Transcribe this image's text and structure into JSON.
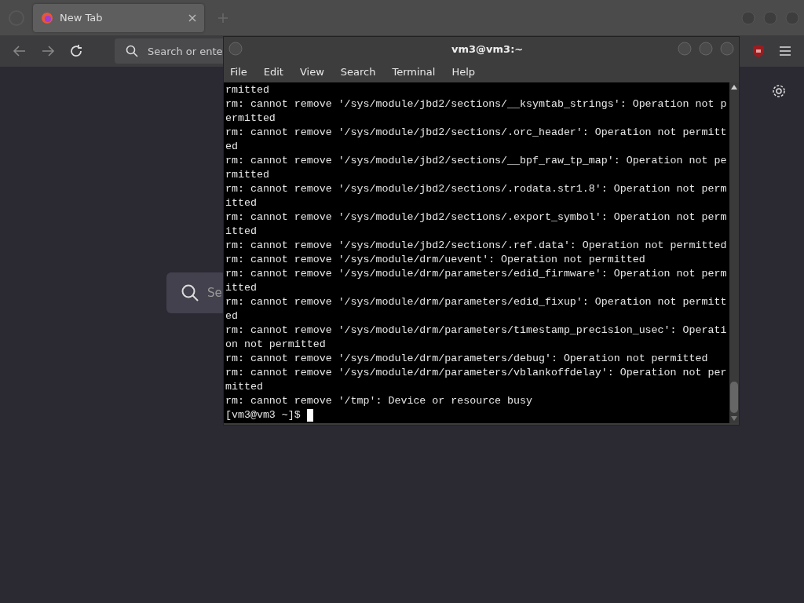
{
  "browser": {
    "tabs": [
      {
        "label": "New Tab",
        "selected": true
      }
    ],
    "address_bar": {
      "placeholder": "Search or ente"
    },
    "page_search": {
      "placeholder": "Se"
    }
  },
  "terminal": {
    "title": "vm3@vm3:~",
    "menu": [
      "File",
      "Edit",
      "View",
      "Search",
      "Terminal",
      "Help"
    ],
    "lines": [
      "rmitted",
      "rm: cannot remove '/sys/module/jbd2/sections/__ksymtab_strings': Operation not p",
      "ermitted",
      "rm: cannot remove '/sys/module/jbd2/sections/.orc_header': Operation not permitt",
      "ed",
      "rm: cannot remove '/sys/module/jbd2/sections/__bpf_raw_tp_map': Operation not pe",
      "rmitted",
      "rm: cannot remove '/sys/module/jbd2/sections/.rodata.str1.8': Operation not perm",
      "itted",
      "rm: cannot remove '/sys/module/jbd2/sections/.export_symbol': Operation not perm",
      "itted",
      "rm: cannot remove '/sys/module/jbd2/sections/.ref.data': Operation not permitted",
      "rm: cannot remove '/sys/module/drm/uevent': Operation not permitted",
      "rm: cannot remove '/sys/module/drm/parameters/edid_firmware': Operation not perm",
      "itted",
      "rm: cannot remove '/sys/module/drm/parameters/edid_fixup': Operation not permitt",
      "ed",
      "rm: cannot remove '/sys/module/drm/parameters/timestamp_precision_usec': Operati",
      "on not permitted",
      "rm: cannot remove '/sys/module/drm/parameters/debug': Operation not permitted",
      "rm: cannot remove '/sys/module/drm/parameters/vblankoffdelay': Operation not per",
      "mitted",
      "rm: cannot remove '/tmp': Device or resource busy"
    ],
    "prompt": "[vm3@vm3 ~]$"
  }
}
